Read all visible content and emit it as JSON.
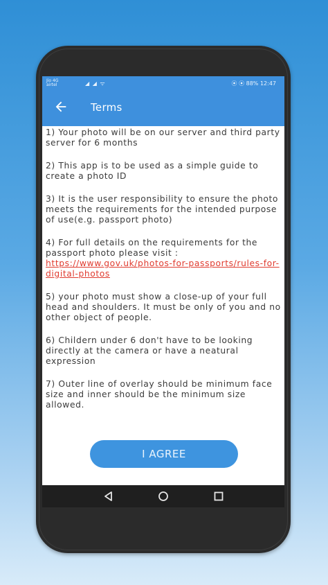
{
  "status_bar": {
    "carrier_top": "Jio 4G",
    "carrier_bottom": "airtel",
    "signal": "◢ ◢ ᯤ",
    "right": "⦿ ⦿ 88% 12:47"
  },
  "header": {
    "title": "Terms",
    "back_icon": "arrow-left-icon"
  },
  "terms": [
    {
      "text": "1) Your photo will be on our server and third party server for 6 months"
    },
    {
      "text": " 2) This app is to be used as a simple guide to create a photo ID"
    },
    {
      "text": " 3) It is the user responsibility to ensure the photo meets the requirements for the intended purpose of use(e.g. passport photo)"
    },
    {
      "text": " 4) For full details on the requirements for the passport photo please visit :",
      "link": "https://www.gov.uk/photos-for-passports/rules-for-digital-photos"
    },
    {
      "text": " 5) your photo must show a close-up of your full head and shoulders. It must be only of you and no other object of people."
    },
    {
      "text": " 6) Childern under 6 don't have to be looking directly at the camera or have a neatural expression"
    },
    {
      "text": " 7) Outer line of overlay should be minimum face size and inner should be the minimum size allowed."
    }
  ],
  "agree_button": {
    "label": "I AGREE"
  },
  "nav_bar": {
    "back": "triangle-back-icon",
    "home": "circle-home-icon",
    "recents": "square-recents-icon"
  },
  "colors": {
    "accent": "#3e90dd",
    "link": "#e03b2f",
    "button": "#3e94df"
  }
}
